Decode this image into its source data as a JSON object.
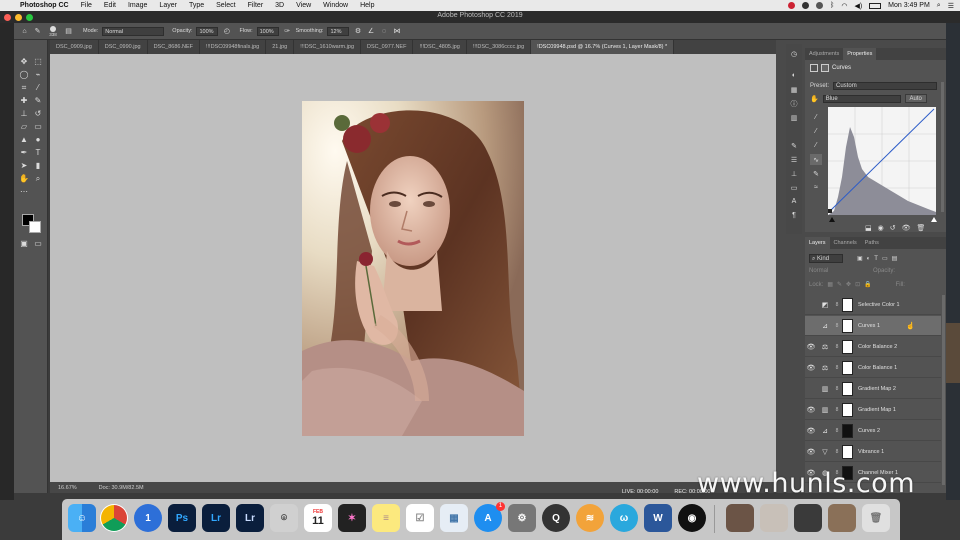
{
  "menubar": {
    "app": "Photoshop CC",
    "items": [
      "File",
      "Edit",
      "Image",
      "Layer",
      "Type",
      "Select",
      "Filter",
      "3D",
      "View",
      "Window",
      "Help"
    ],
    "clock": "Mon 3:49 PM"
  },
  "window": {
    "title": "Adobe Photoshop CC 2019"
  },
  "options": {
    "brush_size": "338",
    "mode_label": "Mode:",
    "mode_value": "Normal",
    "opacity_label": "Opacity:",
    "opacity_value": "100%",
    "flow_label": "Flow:",
    "flow_value": "100%",
    "smoothing_label": "Smoothing:",
    "smoothing_value": "12%"
  },
  "tabs": [
    {
      "label": "DSC_0909.jpg"
    },
    {
      "label": "DSC_0990.jpg"
    },
    {
      "label": "DSC_8686.NEF"
    },
    {
      "label": "!!!DSC09948finals.jpg"
    },
    {
      "label": "21.jpg"
    },
    {
      "label": "!!!DSC_1610warm.jpg"
    },
    {
      "label": "DSC_0977.NEF"
    },
    {
      "label": "!!!DSC_4805.jpg"
    },
    {
      "label": "!!!DSC_3086cccc.jpg"
    },
    {
      "label": "!DSC09948.psd @ 16.7% (Curves 1, Layer Mask/8) *"
    }
  ],
  "status": {
    "zoom": "16.67%",
    "doc": "Doc: 30.9M/82.5M"
  },
  "properties": {
    "tabs": [
      "Adjustments",
      "Properties"
    ],
    "title": "Curves",
    "preset_label": "Preset:",
    "preset_value": "Custom",
    "channel_value": "Blue",
    "auto_label": "Auto"
  },
  "layers": {
    "tabs": [
      "Layers",
      "Channels",
      "Paths"
    ],
    "kind_label": "Kind",
    "blend_value": "Normal",
    "opacity_label": "Opacity:",
    "lock_label": "Lock:",
    "fill_label": "Fill:",
    "items": [
      {
        "name": "Selective Color 1",
        "icon": "selective-color",
        "visible": false
      },
      {
        "name": "Curves 1",
        "icon": "curves",
        "visible": false,
        "selected": true
      },
      {
        "name": "Color Balance 2",
        "icon": "color-balance",
        "visible": true
      },
      {
        "name": "Color Balance 1",
        "icon": "color-balance",
        "visible": true
      },
      {
        "name": "Gradient Map 2",
        "icon": "gradient-map",
        "visible": false
      },
      {
        "name": "Gradient Map 1",
        "icon": "gradient-map",
        "visible": true
      },
      {
        "name": "Curves 2",
        "icon": "curves",
        "visible": true
      },
      {
        "name": "Vibrance 1",
        "icon": "vibrance",
        "visible": true
      },
      {
        "name": "Channel Mixer 1",
        "icon": "channel-mixer",
        "visible": true
      }
    ]
  },
  "live": {
    "live_label": "LIVE: 00:00:00",
    "rec_label": "REC: 00:00:00"
  },
  "watermark": "www.hunls.com",
  "dock": {
    "calendar_month": "FEB",
    "calendar_day": "11",
    "appstore_badge": "1"
  },
  "colors": {
    "canvas_bg": "#bfbfbf",
    "panel": "#535353",
    "accent": "#3f8fd8"
  }
}
